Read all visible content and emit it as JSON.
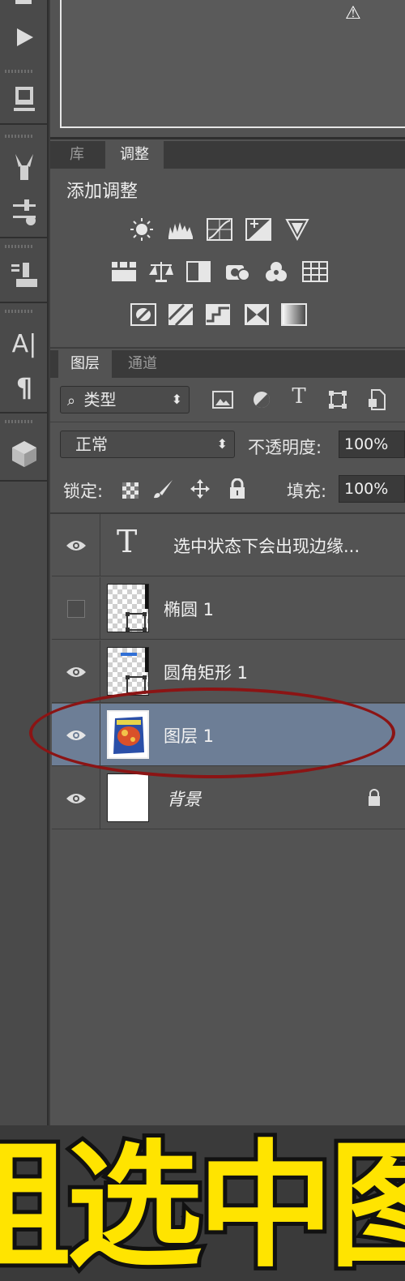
{
  "tools": {
    "icons": [
      "play-icon",
      "3d-cube-menu-icon",
      "brush-tool-icon",
      "sliders-tool-icon",
      "stamp-icon",
      "character-icon",
      "paragraph-icon",
      "3d-box-icon"
    ],
    "character_label": "A|",
    "paragraph_label": "¶"
  },
  "navigator": {
    "warning_glyph": "⚠"
  },
  "adjust_tabs": {
    "tab1": "库",
    "tab2": "调整"
  },
  "adjustments": {
    "title": "添加调整"
  },
  "layers_tabs": {
    "tab1": "图层",
    "tab2": "通道"
  },
  "filter": {
    "kind_label": "类型",
    "search_glyph": "⌕",
    "arrows": "⬍",
    "icons": [
      "image-filter-icon",
      "adjustment-filter-icon",
      "type-filter-icon",
      "shape-filter-icon",
      "smart-object-filter-icon"
    ],
    "type_glyph": "T"
  },
  "blend": {
    "mode": "正常",
    "arrows": "⬍",
    "opacity_label": "不透明度:",
    "opacity_value": "100%"
  },
  "lock": {
    "label": "锁定:",
    "fill_label": "填充:",
    "fill_value": "100%"
  },
  "layers": [
    {
      "name": "选中状态下会出现边缘...",
      "visible": true,
      "kind": "text",
      "type_glyph": "T"
    },
    {
      "name": "椭圆 1",
      "visible": false,
      "kind": "shape"
    },
    {
      "name": "圆角矩形 1",
      "visible": true,
      "kind": "shape"
    },
    {
      "name": "图层 1",
      "visible": true,
      "kind": "image",
      "selected": true
    },
    {
      "name": "背景",
      "visible": true,
      "kind": "background",
      "locked": true
    }
  ],
  "banner": {
    "text": "组选中图"
  },
  "colors": {
    "selected_row": "#6d7e96",
    "banner_yellow": "#ffe400",
    "highlight_ring": "#8b1414"
  }
}
